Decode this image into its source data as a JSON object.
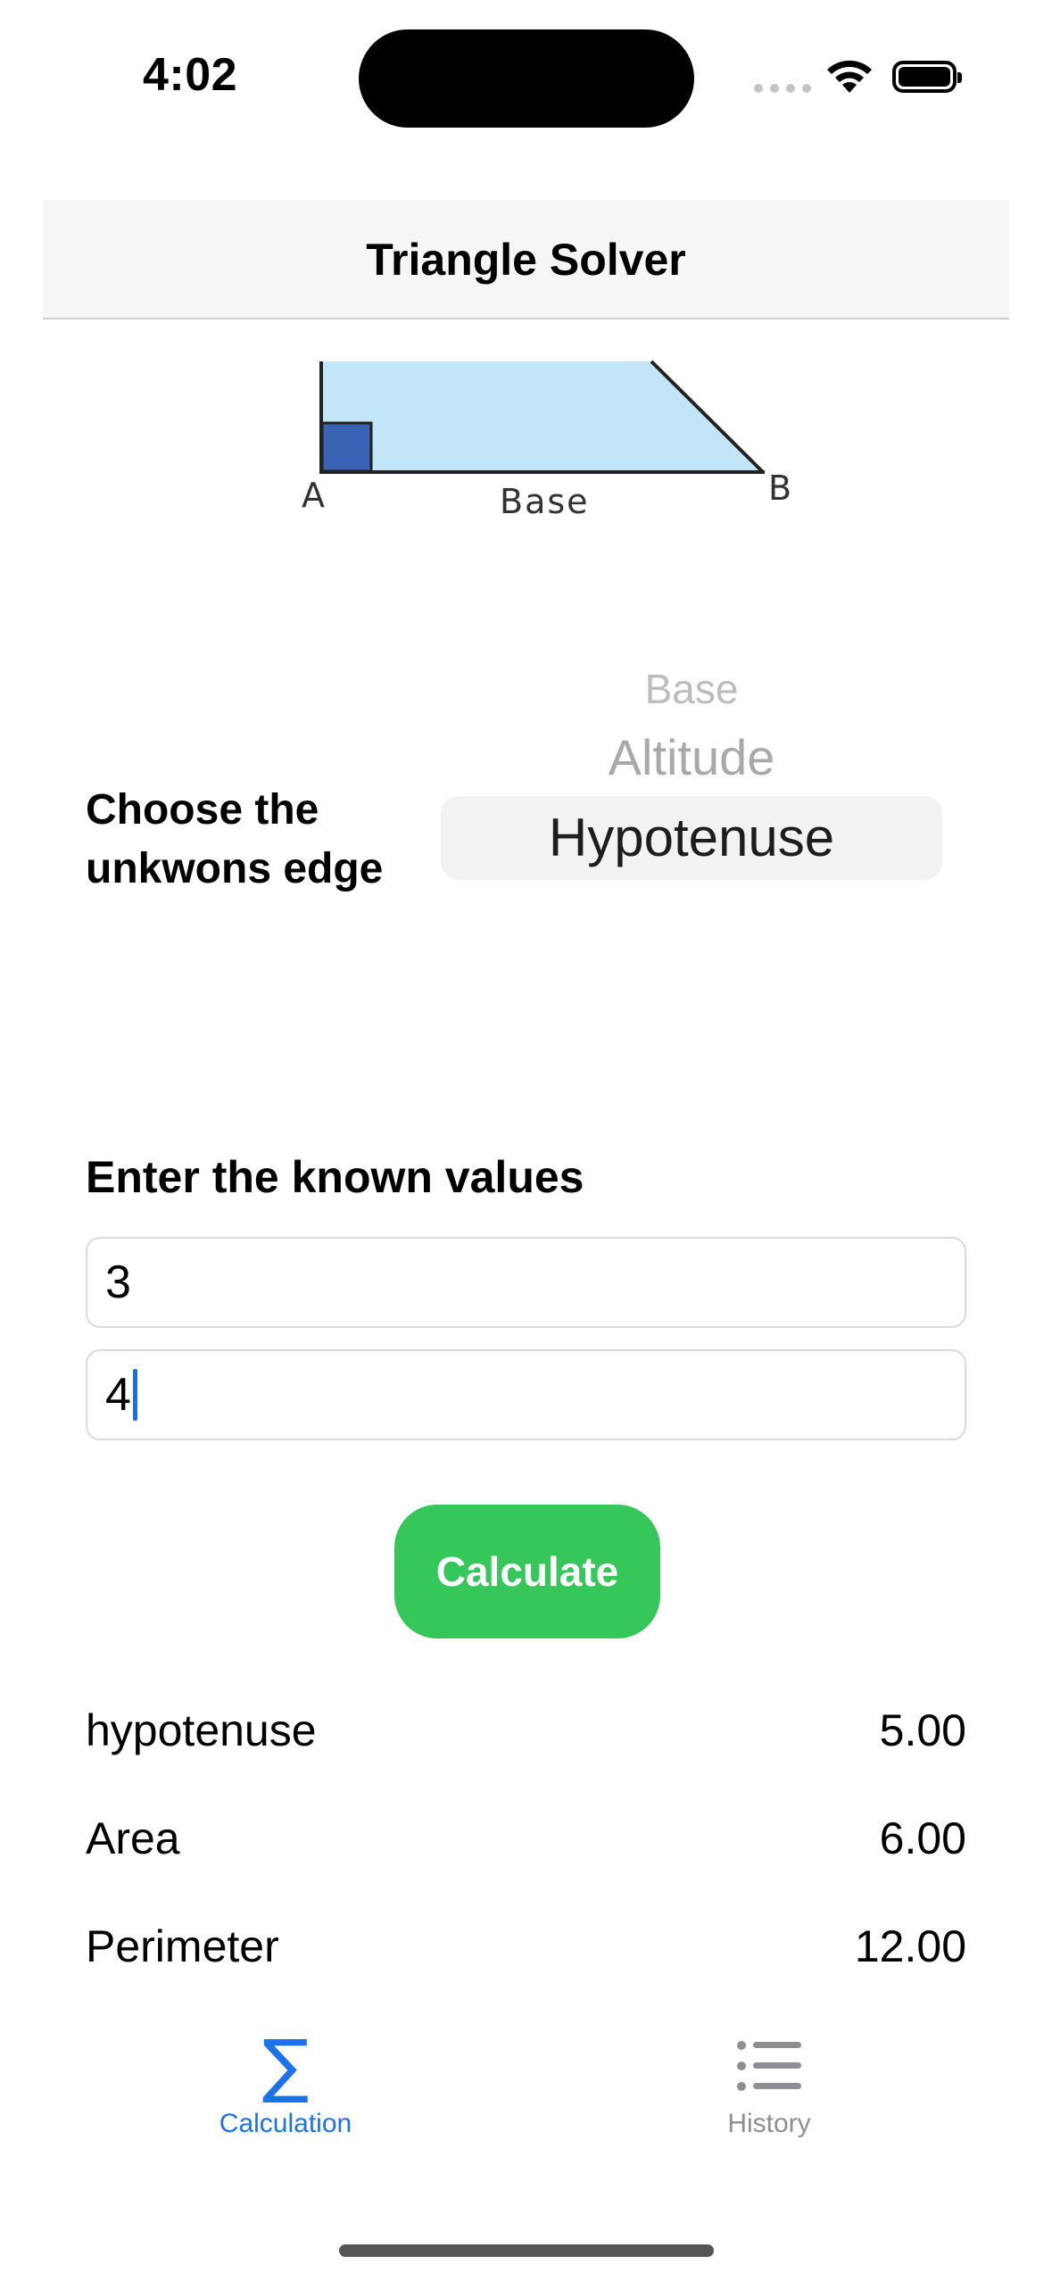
{
  "status_bar": {
    "time": "4:02"
  },
  "nav": {
    "title": "Triangle Solver"
  },
  "diagram": {
    "label_a": "A",
    "label_b": "B",
    "label_base": "Base"
  },
  "picker": {
    "label": "Choose the\nunkwons edge",
    "options": [
      "Base",
      "Altitude",
      "Hypotenuse"
    ],
    "selected": "Hypotenuse"
  },
  "inputs": {
    "label": "Enter the known values",
    "value_1": "3",
    "value_2": "4"
  },
  "calculate_button": "Calculate",
  "results": [
    {
      "label": "hypotenuse",
      "value": "5.00"
    },
    {
      "label": "Area",
      "value": "6.00"
    },
    {
      "label": "Perimeter",
      "value": "12.00"
    }
  ],
  "tabs": [
    {
      "label": "Calculation",
      "icon": "sigma-icon",
      "active": true
    },
    {
      "label": "History",
      "icon": "list-icon",
      "active": false
    }
  ],
  "colors": {
    "accent": "#1a73e8",
    "button": "#35c759",
    "triangle_fill": "#c2e6f7",
    "right_angle": "#3a63b5"
  }
}
